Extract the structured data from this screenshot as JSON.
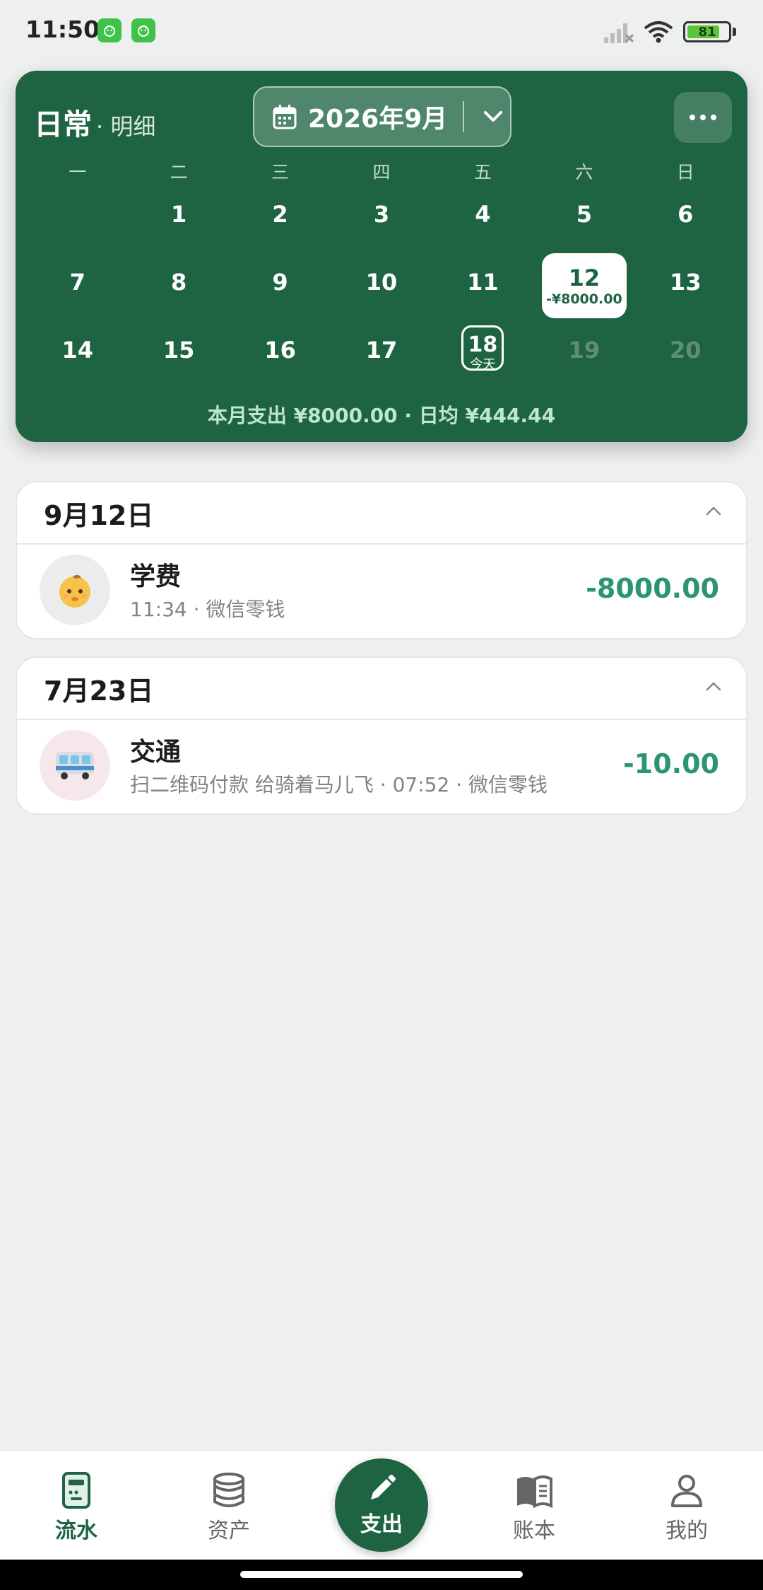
{
  "status": {
    "time": "11:50",
    "battery": "81",
    "battery_level": 0.81
  },
  "header": {
    "title": "日常",
    "subtitle": "· 明细",
    "month_label": "2026年9月"
  },
  "calendar": {
    "weekdays": [
      "一",
      "二",
      "三",
      "四",
      "五",
      "六",
      "日"
    ],
    "selected_amount": "-¥8000.00",
    "today_label": "今天",
    "summary": "本月支出 ¥8000.00 · 日均 ¥444.44",
    "days": [
      {
        "n": ""
      },
      {
        "n": "1"
      },
      {
        "n": "2"
      },
      {
        "n": "3"
      },
      {
        "n": "4"
      },
      {
        "n": "5"
      },
      {
        "n": "6"
      },
      {
        "n": "7"
      },
      {
        "n": "8"
      },
      {
        "n": "9"
      },
      {
        "n": "10"
      },
      {
        "n": "11"
      },
      {
        "n": "12",
        "selected": true
      },
      {
        "n": "13"
      },
      {
        "n": "14"
      },
      {
        "n": "15"
      },
      {
        "n": "16"
      },
      {
        "n": "17"
      },
      {
        "n": "18",
        "today": true
      },
      {
        "n": "19",
        "muted": true
      },
      {
        "n": "20",
        "muted": true
      }
    ]
  },
  "groups": [
    {
      "date": "9月12日",
      "tx": {
        "icon": "baby-icon",
        "avatar_color": "#ececec",
        "title": "学费",
        "meta": "11:34 · 微信零钱",
        "amount": "-8000.00"
      }
    },
    {
      "date": "7月23日",
      "tx": {
        "icon": "bus-icon",
        "avatar_color": "#f6e8ea",
        "title": "交通",
        "meta": "扫二维码付款 给骑着马儿飞 · 07:52 · 微信零钱",
        "amount": "-10.00"
      }
    }
  ],
  "nav": {
    "flow": "流水",
    "assets": "资产",
    "expense": "支出",
    "books": "账本",
    "mine": "我的"
  },
  "colors": {
    "brand": "#1e6443",
    "amount": "#2a9474"
  }
}
